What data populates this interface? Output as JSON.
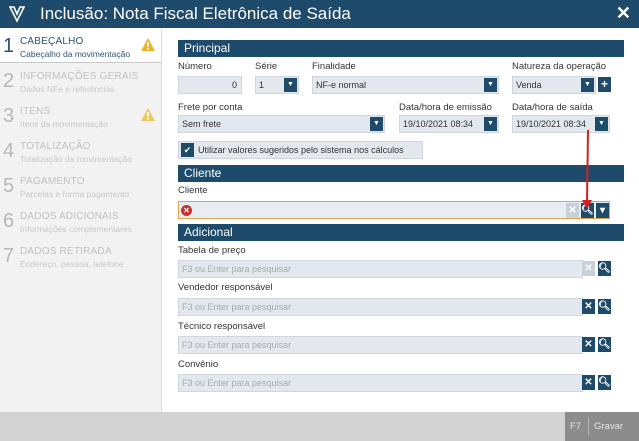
{
  "window": {
    "title": "Inclusão: Nota Fiscal Eletrônica de Saída",
    "close_label": "✕"
  },
  "steps": [
    {
      "num": "1",
      "title": "CABEÇALHO",
      "subtitle": "Cabeçalho da movimentação",
      "warning": true,
      "active": true
    },
    {
      "num": "2",
      "title": "INFORMAÇÕES GERAIS",
      "subtitle": "Dados NFe e referências",
      "warning": false,
      "active": false
    },
    {
      "num": "3",
      "title": "ITENS",
      "subtitle": "Itens da movimentação",
      "warning": true,
      "active": false
    },
    {
      "num": "4",
      "title": "TOTALIZAÇÃO",
      "subtitle": "Totalização da movimentação",
      "warning": false,
      "active": false
    },
    {
      "num": "5",
      "title": "PAGAMENTO",
      "subtitle": "Parcelas e forma pagamento",
      "warning": false,
      "active": false
    },
    {
      "num": "6",
      "title": "DADOS ADICIONAIS",
      "subtitle": "Informações complementares",
      "warning": false,
      "active": false
    },
    {
      "num": "7",
      "title": "DADOS RETIRADA",
      "subtitle": "Endereço, pessoa, telefone",
      "warning": false,
      "active": false
    }
  ],
  "principal": {
    "section_title": "Principal",
    "numero": {
      "label": "Número",
      "value": "0"
    },
    "serie": {
      "label": "Série",
      "value": "1"
    },
    "finalidade": {
      "label": "Finalidade",
      "value": "NF-e normal"
    },
    "natureza": {
      "label": "Natureza da operação",
      "value": "Venda",
      "add": "+"
    },
    "frete": {
      "label": "Frete por conta",
      "value": "Sem frete"
    },
    "emissao": {
      "label": "Data/hora de emissão",
      "value": "19/10/2021 08:34"
    },
    "saida": {
      "label": "Data/hora de saída",
      "value": "19/10/2021 08:34"
    },
    "check_label": "Utilizar valores sugeridos pelo sistema nos cálculos"
  },
  "cliente": {
    "section_title": "Cliente",
    "label": "Cliente",
    "value": ""
  },
  "adicional": {
    "section_title": "Adicional",
    "fields": [
      {
        "label": "Tabela de preço",
        "placeholder": "F3 ou Enter para pesquisar"
      },
      {
        "label": "Vendedor responsável",
        "placeholder": "F3 ou Enter para pesquisar"
      },
      {
        "label": "Técnico responsável",
        "placeholder": "F3 ou Enter para pesquisar"
      },
      {
        "label": "Convênio",
        "placeholder": "F3 ou Enter para pesquisar"
      }
    ]
  },
  "footer": {
    "key": "F7",
    "save_label": "Gravar"
  },
  "colors": {
    "header": "#1e4a6b",
    "warning": "#f0b323",
    "error": "#d02b2b",
    "annotation_arrow": "#d32020"
  }
}
